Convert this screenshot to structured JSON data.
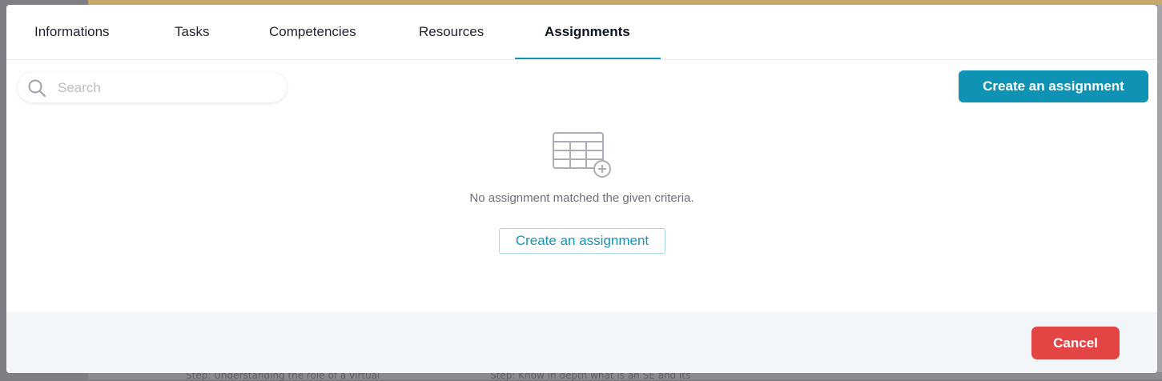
{
  "tabs": [
    {
      "label": "Informations",
      "active": false
    },
    {
      "label": "Tasks",
      "active": false
    },
    {
      "label": "Competencies",
      "active": false
    },
    {
      "label": "Resources",
      "active": false
    },
    {
      "label": "Assignments",
      "active": true
    }
  ],
  "search": {
    "placeholder": "Search",
    "value": "",
    "icon": "search-icon"
  },
  "toolbar": {
    "create_label": "Create an assignment"
  },
  "empty_state": {
    "icon": "table-add-icon",
    "message": "No assignment matched the given criteria.",
    "create_label": "Create an assignment"
  },
  "footer": {
    "cancel_label": "Cancel"
  },
  "background": {
    "step_left": "Step: Understanding the role of a virtual",
    "step_right": "Step: Know in depth what is an SE and its"
  },
  "colors": {
    "accent": "#0f93b5",
    "danger": "#e24544",
    "footer_bg": "#f3f6f9"
  }
}
